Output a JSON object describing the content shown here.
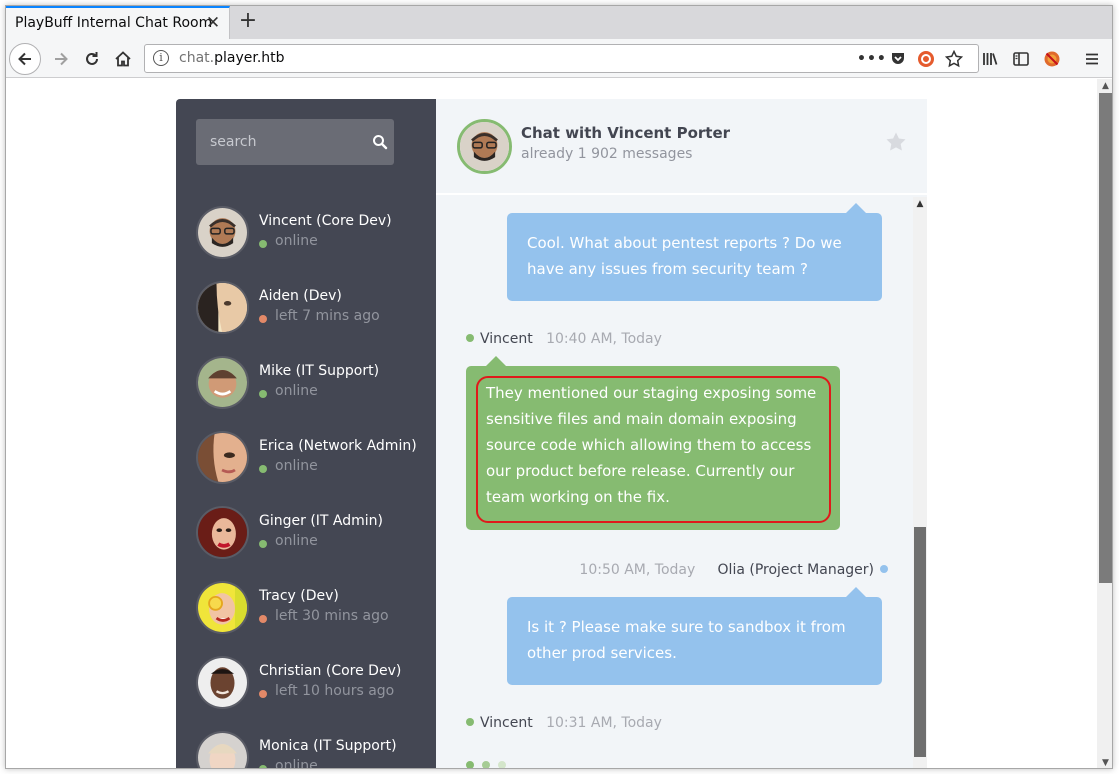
{
  "browser": {
    "tab_title": "PlayBuff Internal Chat Room",
    "url_prefix": "chat.",
    "url_domain": "player.htb"
  },
  "search": {
    "placeholder": "search"
  },
  "people": [
    {
      "name": "Vincent (Core Dev)",
      "status": "online",
      "state": "online"
    },
    {
      "name": "Aiden (Dev)",
      "status": "left 7 mins ago",
      "state": "offline"
    },
    {
      "name": "Mike (IT Support)",
      "status": "online",
      "state": "online"
    },
    {
      "name": "Erica (Network Admin)",
      "status": "online",
      "state": "online"
    },
    {
      "name": "Ginger (IT Admin)",
      "status": "online",
      "state": "online"
    },
    {
      "name": "Tracy (Dev)",
      "status": "left 30 mins ago",
      "state": "offline"
    },
    {
      "name": "Christian (Core Dev)",
      "status": "left 10 hours ago",
      "state": "offline"
    },
    {
      "name": "Monica (IT Support)",
      "status": "online",
      "state": "online"
    }
  ],
  "chat_header": {
    "title": "Chat with Vincent Porter",
    "message_count": "already 1 902 messages"
  },
  "messages": [
    {
      "text": "Cool. What about pentest reports ? Do we have any issues from security team ?"
    },
    {
      "sender": "Vincent",
      "time": "10:40 AM, Today",
      "text": "They mentioned our staging exposing some sensitive files and main domain exposing source code which allowing them to access our product before release. Currently our team working on the fix."
    },
    {
      "sender": "Olia (Project Manager)",
      "time": "10:50 AM, Today",
      "text": "Is it ? Please make sure to sandbox it from other prod services."
    },
    {
      "sender": "Vincent",
      "time": "10:31 AM, Today"
    }
  ],
  "colors": {
    "sidebar_bg": "#444753",
    "online": "#86bb71",
    "offline": "#e38968",
    "their_bubble": "#86bb71",
    "my_bubble": "#94c2ed",
    "highlight_border": "#e0191b"
  }
}
